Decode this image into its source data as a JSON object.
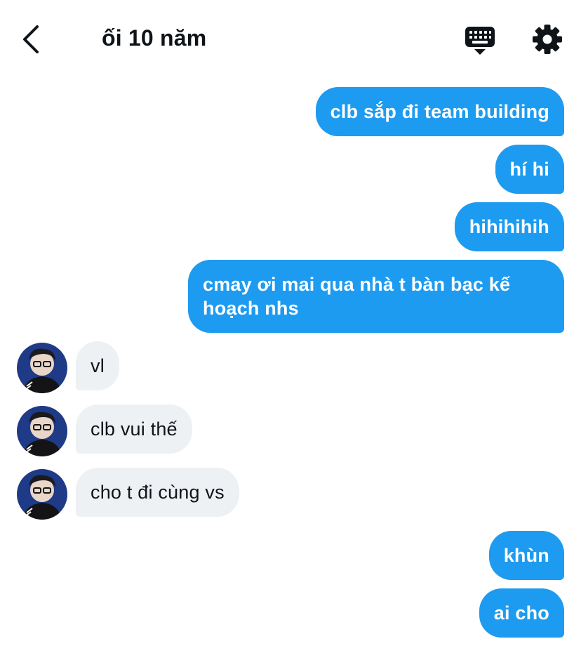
{
  "header": {
    "title": "ối 10 năm",
    "back_icon": "chevron-left-icon",
    "keyboard_icon": "keyboard-icon",
    "settings_icon": "gear-icon"
  },
  "colors": {
    "outgoing_bubble": "#1d9bf0",
    "incoming_bubble": "#eef1f4",
    "text": "#0f1419"
  },
  "messages": [
    {
      "from": "me",
      "text": "clb sắp đi team building"
    },
    {
      "from": "me",
      "text": "hí hi"
    },
    {
      "from": "me",
      "text": "hihihihih"
    },
    {
      "from": "me",
      "text": "cmay ơi mai qua nhà t bàn bạc kế hoạch nhs"
    },
    {
      "from": "them",
      "text": "vl"
    },
    {
      "from": "them",
      "text": "clb vui thế"
    },
    {
      "from": "them",
      "text": "cho t đi cùng vs"
    },
    {
      "from": "me",
      "text": "khùn"
    },
    {
      "from": "me",
      "text": "ai cho"
    }
  ]
}
